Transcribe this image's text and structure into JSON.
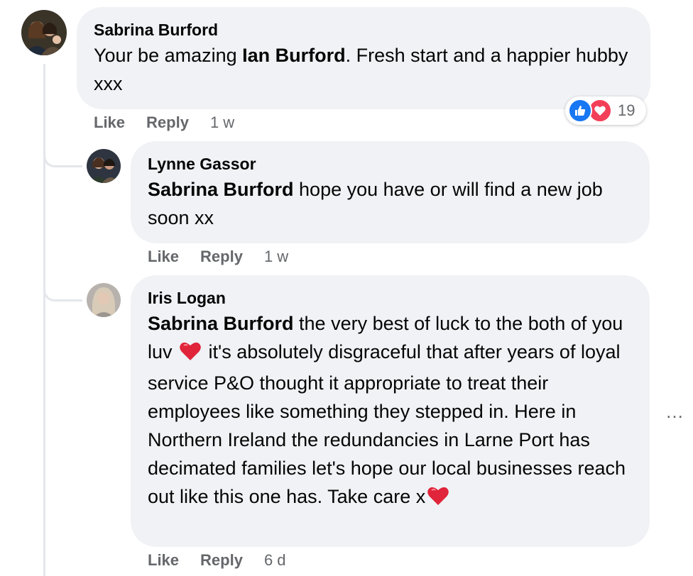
{
  "comments": [
    {
      "author": "Sabrina Burford",
      "text_parts": [
        "Your be amazing ",
        "Ian Burford",
        ". Fresh start and a happier hubby xxx"
      ],
      "actions": {
        "like": "Like",
        "reply": "Reply",
        "time": "1 w"
      },
      "reactions": {
        "icons": [
          "like-icon",
          "love-icon"
        ],
        "count": "19"
      }
    },
    {
      "author": "Lynne Gassor",
      "mention": "Sabrina Burford",
      "text": " hope you have or will find a new job soon xx",
      "actions": {
        "like": "Like",
        "reply": "Reply",
        "time": "1 w"
      }
    },
    {
      "author": "Iris Logan",
      "mention": "Sabrina Burford",
      "text_a": " the very best of luck to the both of you luv ",
      "text_b": " it's absolutely disgraceful that after years of loyal service P&O thought it appropriate to treat their employees like something they stepped in. Here in Northern Ireland the redundancies in Larne Port has decimated families let's hope our local businesses reach out like this one has. Take care x",
      "actions": {
        "like": "Like",
        "reply": "Reply",
        "time": "6 d"
      }
    }
  ],
  "more_icon": "…",
  "colors": {
    "like_blue": "#1877f2",
    "love_red": "#f33e58",
    "bubble": "#f0f2f5",
    "meta_gray": "#65676b"
  }
}
